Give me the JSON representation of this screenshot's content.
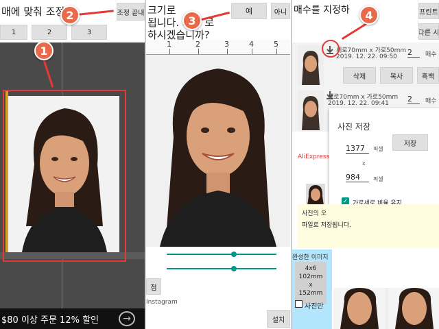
{
  "panel1": {
    "title": "매에 맞춰 조정",
    "finish_button": "조정 끝내",
    "size_buttons": [
      "1",
      "2",
      "3"
    ],
    "ad_text": "$80 이상 주문 12% 할인",
    "ad_arrow": "→"
  },
  "panel2": {
    "lines": [
      "크기로",
      "됩니다. 저장 로",
      "하시겠습니까?"
    ],
    "yes_button": "예",
    "no_button": "아니",
    "ruler_numbers": [
      "1",
      "2",
      "3",
      "4",
      "5"
    ],
    "left_button": "점",
    "instagram_label": "Instagram",
    "bottom_right_button": "설치"
  },
  "panel3": {
    "title": "매수를 지정하",
    "print_button": "프린트",
    "other_button": "다른 시",
    "items": [
      {
        "size": "세로70mm x 가로50mm",
        "date": "2019. 12. 22. 09:50",
        "copies": "2",
        "copies_label": "매수"
      },
      {
        "size": "세로70mm x 가로50mm",
        "date": "2019. 12. 22. 09:41",
        "copies": "2",
        "copies_label": "매수"
      }
    ],
    "actions": [
      "삭제",
      "복사",
      "흑백"
    ],
    "ad_label": "AliExpress",
    "dialog": {
      "title": "사진 저장",
      "width_value": "1377",
      "height_value": "984",
      "unit": "픽셀",
      "times": "x",
      "save_button": "저장",
      "keep_ratio": "가로세로 비율 유지"
    },
    "note_lines": [
      "사진의 오",
      "파일로 저장됩니다."
    ],
    "completed_label": "완성한 이미지",
    "size_box": [
      "4x6",
      "102mm",
      "x",
      "152mm"
    ],
    "photo_only": "사진만"
  },
  "badges": [
    "1",
    "2",
    "3",
    "4"
  ],
  "colors": {
    "badge": "#e86a4a",
    "arrow": "#e53935",
    "accent": "#009688"
  }
}
